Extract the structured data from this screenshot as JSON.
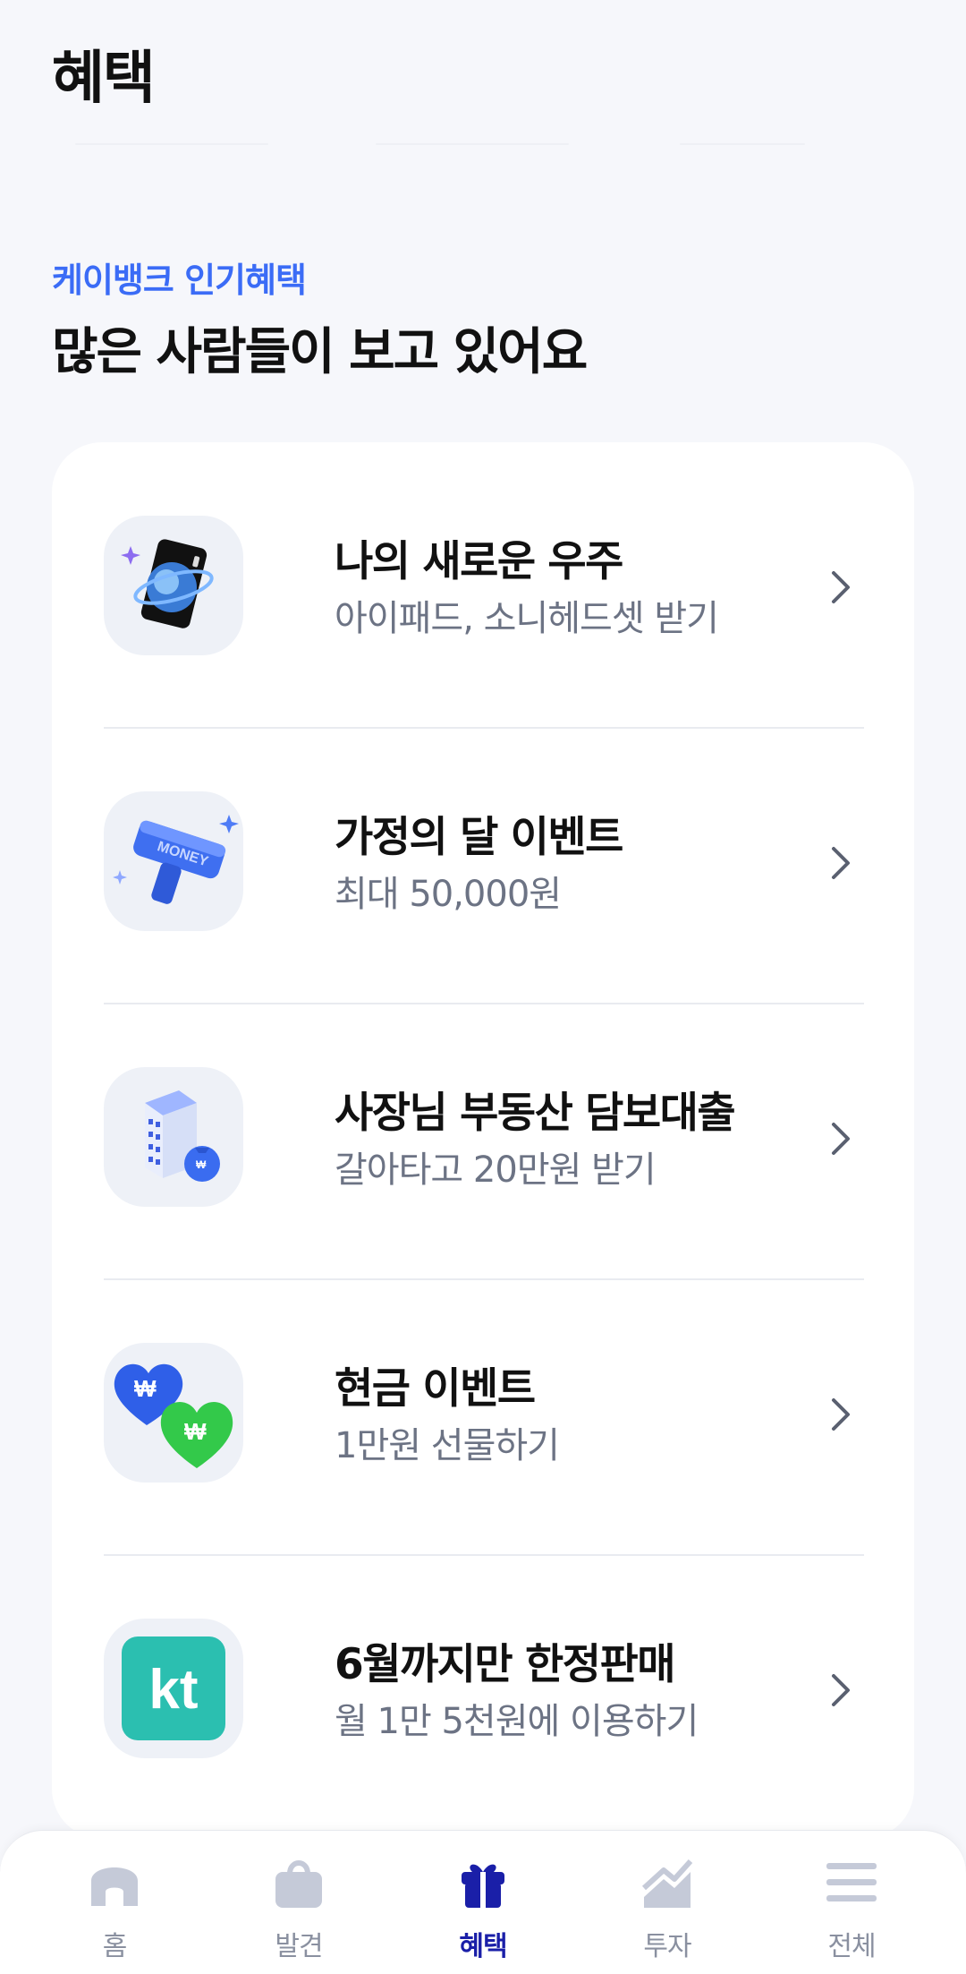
{
  "header": {
    "title": "혜택"
  },
  "section": {
    "eyebrow": "케이뱅크 인기혜택",
    "title": "많은 사람들이 보고 있어요"
  },
  "benefits": [
    {
      "title": "나의 새로운 우주",
      "subtitle": "아이패드, 소니헤드셋 받기",
      "icon": "space-card-icon"
    },
    {
      "title": "가정의 달 이벤트",
      "subtitle": "최대 50,000원",
      "icon": "money-gun-icon"
    },
    {
      "title": "사장님 부동산 담보대출",
      "subtitle": "갈아타고 20만원 받기",
      "icon": "building-money-bag-icon"
    },
    {
      "title": "현금 이벤트",
      "subtitle": "1만원 선물하기",
      "icon": "won-hearts-icon"
    },
    {
      "title": "6월까지만 한정판매",
      "subtitle": "월 1만 5천원에 이용하기",
      "icon": "kt-logo-icon",
      "logo_text": "kt"
    }
  ],
  "tabbar": {
    "items": [
      {
        "label": "홈",
        "icon": "home-icon",
        "active": false
      },
      {
        "label": "발견",
        "icon": "shopping-bag-icon",
        "active": false
      },
      {
        "label": "혜택",
        "icon": "gift-icon",
        "active": true
      },
      {
        "label": "투자",
        "icon": "chart-icon",
        "active": false
      },
      {
        "label": "전체",
        "icon": "menu-icon",
        "active": false
      }
    ]
  },
  "colors": {
    "accent": "#3b6cf6",
    "active_tab": "#1a1fa8",
    "inactive_icon": "#c5cad8",
    "kt_green": "#2bbfb0"
  }
}
